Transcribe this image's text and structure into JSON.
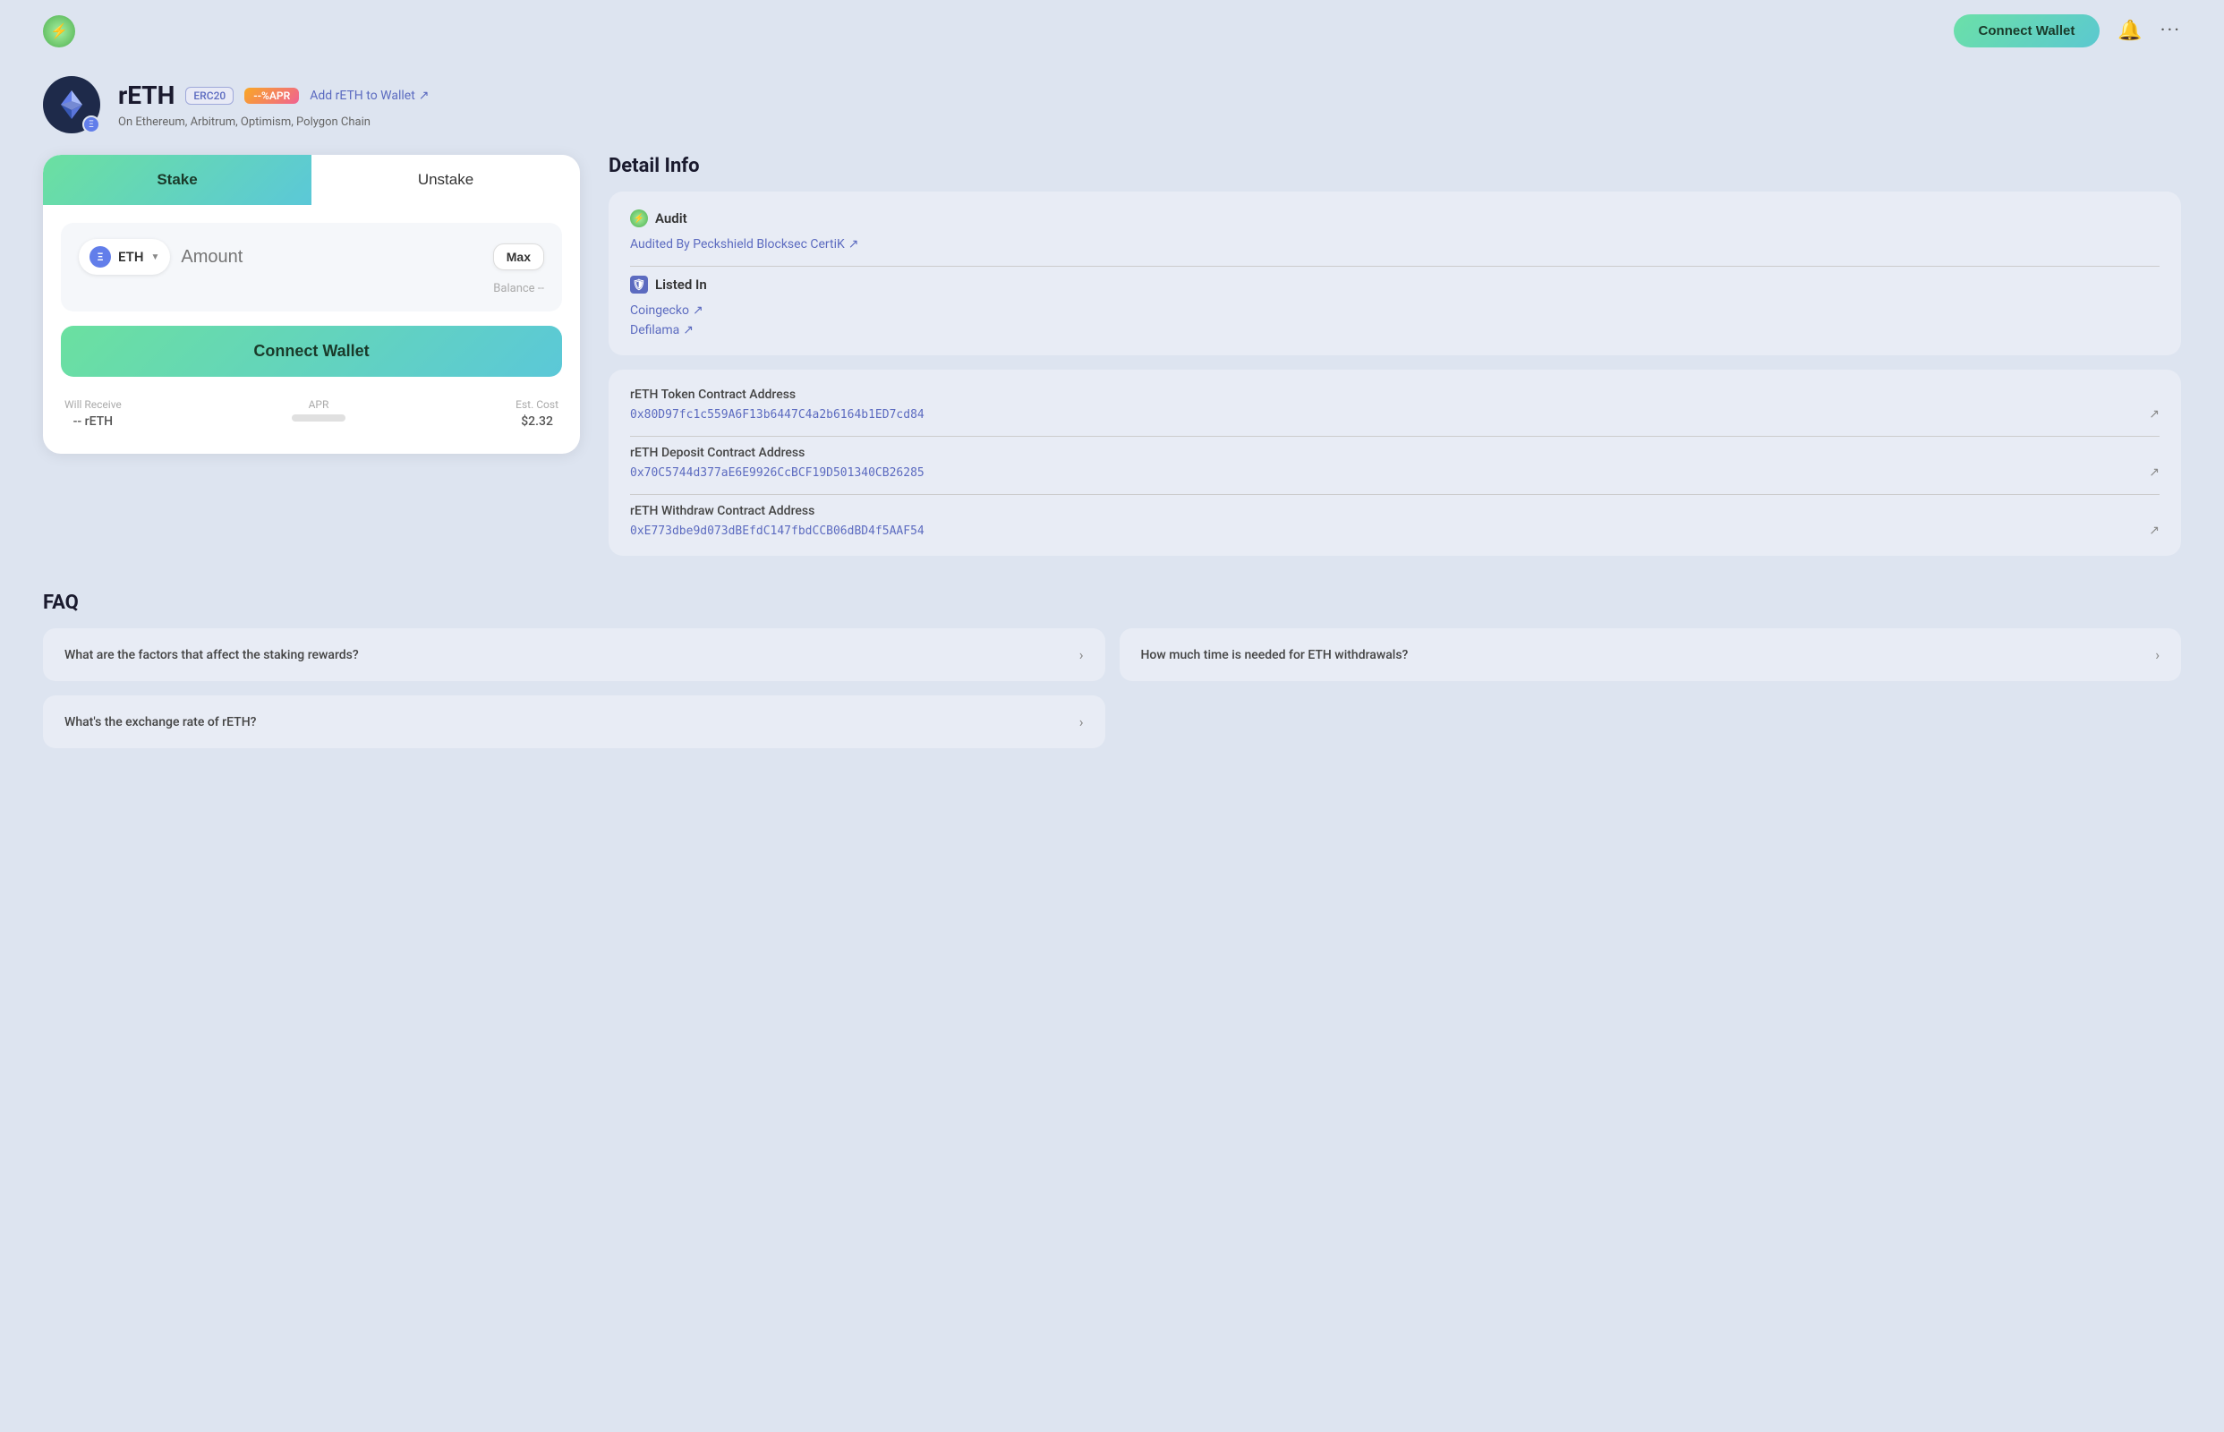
{
  "header": {
    "logo_icon": "⚡",
    "connect_wallet_label": "Connect Wallet",
    "bell_icon": "🔔",
    "more_icon": "···"
  },
  "token": {
    "name": "rETH",
    "tag_erc20": "ERC20",
    "tag_apr": "--%APR",
    "add_wallet_link": "Add rETH to Wallet",
    "subtitle": "On Ethereum, Arbitrum, Optimism, Polygon Chain"
  },
  "stake_panel": {
    "tab_stake": "Stake",
    "tab_unstake": "Unstake",
    "eth_label": "ETH",
    "amount_placeholder": "Amount",
    "max_label": "Max",
    "balance_label": "Balance --",
    "connect_wallet_label": "Connect Wallet",
    "will_receive_label": "Will Receive",
    "will_receive_value": "-- rETH",
    "apr_label": "APR",
    "est_cost_label": "Est. Cost",
    "est_cost_value": "$2.32"
  },
  "detail_info": {
    "title": "Detail Info",
    "audit_label": "Audit",
    "audit_link": "Audited By Peckshield Blocksec CertiK",
    "listed_label": "Listed In",
    "coingecko_link": "Coingecko",
    "defilama_link": "Defilama",
    "contracts": [
      {
        "label": "rETH Token Contract Address",
        "address": "0x80D97fc1c559A6F13b6447C4a2b6164b1ED7cd84"
      },
      {
        "label": "rETH Deposit Contract Address",
        "address": "0x70C5744d377aE6E9926CcBCF19D501340CB26285"
      },
      {
        "label": "rETH Withdraw Contract Address",
        "address": "0xE773dbe9d073dBEfdC147fbdCCB06dBD4f5AAF54"
      }
    ]
  },
  "faq": {
    "title": "FAQ",
    "items": [
      {
        "question": "What are the factors that affect the staking rewards?"
      },
      {
        "question": "How much time is needed for ETH withdrawals?"
      },
      {
        "question": "What's the exchange rate of rETH?"
      }
    ]
  }
}
